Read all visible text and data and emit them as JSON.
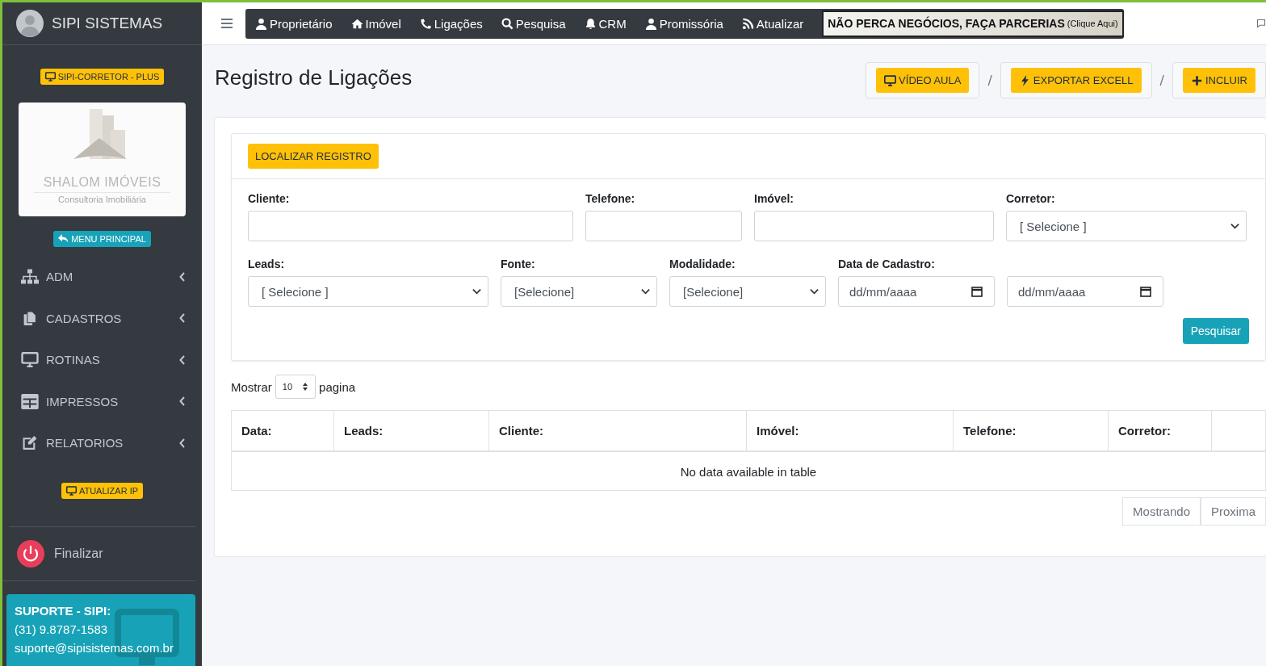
{
  "brand": {
    "title": "SIPI SISTEMAS"
  },
  "sidebar": {
    "badge": "SIPI-CORRETOR - PLUS",
    "logo": {
      "name": "SHALOM IMÓVEIS",
      "tagline": "Consultoria Imobiliária"
    },
    "menu_button": "MENU PRINCIPAL",
    "items": [
      "ADM",
      "CADASTROS",
      "ROTINAS",
      "IMPRESSOS",
      "RELATORIOS"
    ],
    "update_button": "ATUALIZAR IP",
    "logout": "Finalizar",
    "support": {
      "title": "SUPORTE - SIPI:",
      "phone": "(31) 9.8787-1583",
      "email": "suporte@sipisistemas.com.br"
    }
  },
  "navbar": {
    "items": [
      "Proprietário",
      "Imóvel",
      "Ligações",
      "Pesquisa",
      "CRM",
      "Promissória",
      "Atualizar"
    ],
    "banner": {
      "text": "NÃO PERCA NEGÓCIOS, FAÇA PARCERIAS",
      "hint": "(Clique Aqui)"
    }
  },
  "page": {
    "title": "Registro de Ligações",
    "actions": [
      "VÍDEO AULA",
      "EXPORTAR EXCELL",
      "INCLUIR"
    ],
    "separator": "/"
  },
  "filter": {
    "header_button": "LOCALIZAR REGISTRO",
    "fields": [
      {
        "label": "Cliente:",
        "kind": "text"
      },
      {
        "label": "Telefone:",
        "kind": "text"
      },
      {
        "label": "Imóvel:",
        "kind": "text"
      },
      {
        "label": "Corretor:",
        "kind": "select",
        "value": "[ Selecione ]"
      },
      {
        "label": "Leads:",
        "kind": "select",
        "value": "[ Selecione ]"
      },
      {
        "label": "Fonte:",
        "kind": "select",
        "value": "[Selecione]"
      },
      {
        "label": "Modalidade:",
        "kind": "select",
        "value": "[Selecione]"
      },
      {
        "label": "Data de Cadastro:",
        "kind": "date",
        "placeholder": "dd/mm/aaaa"
      },
      {
        "kind": "date",
        "placeholder": "dd/mm/aaaa"
      }
    ],
    "search_button": "Pesquisar"
  },
  "table": {
    "length": {
      "before": "Mostrar",
      "value": "10",
      "after": "pagina"
    },
    "columns": [
      "Data:",
      "Leads:",
      "Cliente:",
      "Imóvel:",
      "Telefone:",
      "Corretor:"
    ],
    "empty_message": "No data available in table",
    "pagination": [
      "Mostrando",
      "Proxima"
    ]
  }
}
